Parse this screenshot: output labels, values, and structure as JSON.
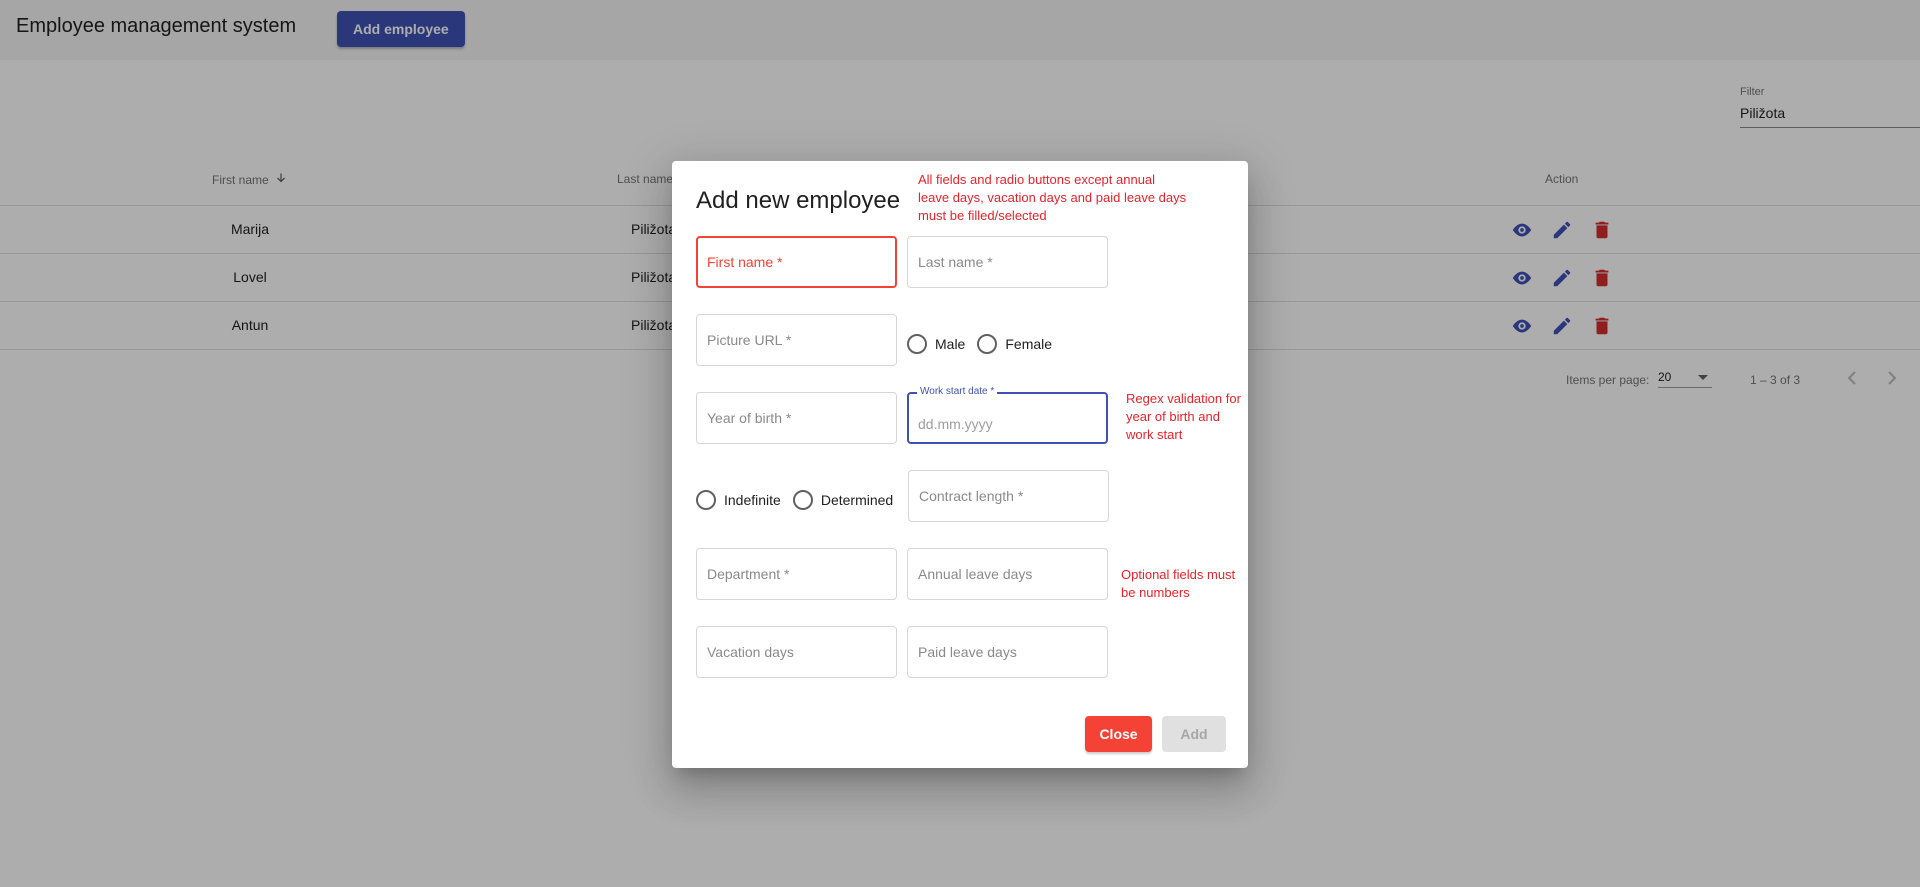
{
  "app": {
    "title": "Employee management system",
    "add_button": "Add employee"
  },
  "filter": {
    "label": "Filter",
    "value": "Piližota"
  },
  "table": {
    "headers": {
      "first_name": "First name",
      "last_name": "Last name",
      "action": "Action"
    },
    "rows": [
      {
        "first_name": "Marija",
        "last_name": "Piližota"
      },
      {
        "first_name": "Lovel",
        "last_name": "Piližota"
      },
      {
        "first_name": "Antun",
        "last_name": "Piližota"
      }
    ]
  },
  "paginator": {
    "items_label": "Items per page:",
    "page_size": "20",
    "range": "1 – 3 of 3"
  },
  "dialog": {
    "title": "Add new employee",
    "notes": {
      "top": "All fields and radio buttons except annual leave days, vacation days and paid leave days must be filled/selected",
      "regex": "Regex validation for year of birth and work start",
      "optional": "Optional fields must be numbers"
    },
    "fields": {
      "first_name": "First name *",
      "last_name": "Last name *",
      "picture_url": "Picture URL *",
      "year_of_birth": "Year of birth *",
      "work_start_label": "Work start date *",
      "work_start_placeholder": "dd.mm.yyyy",
      "contract_length": "Contract length *",
      "department": "Department *",
      "annual_leave": "Annual leave days",
      "vacation": "Vacation days",
      "paid_leave": "Paid leave days"
    },
    "gender": {
      "male": "Male",
      "female": "Female"
    },
    "contract": {
      "indefinite": "Indefinite",
      "determined": "Determined"
    },
    "buttons": {
      "close": "Close",
      "add": "Add"
    }
  },
  "colors": {
    "primary": "#3f51b5",
    "warn": "#f44336",
    "annotation": "#e8232b",
    "delete": "#d32f2f"
  },
  "icons": [
    "arrow-down-icon",
    "eye-icon",
    "pencil-icon",
    "trash-icon",
    "chevron-left-icon",
    "chevron-right-icon"
  ]
}
